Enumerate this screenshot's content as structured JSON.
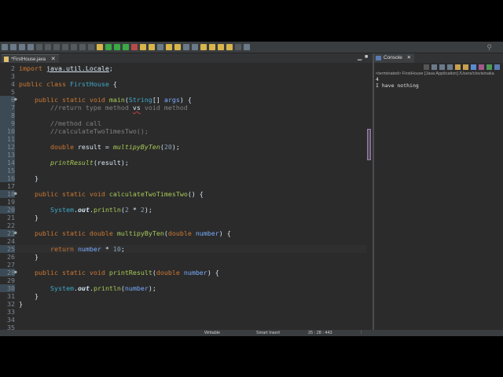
{
  "editor": {
    "tab_label": "*FirstHouse.java",
    "current_line": 25,
    "lines": [
      {
        "n": 2,
        "t": [
          [
            "k",
            "import "
          ],
          [
            "u",
            "java.util.Locale"
          ],
          [
            "",
            "; "
          ]
        ]
      },
      {
        "n": 3,
        "t": []
      },
      {
        "n": 4,
        "t": [
          [
            "k",
            "public class "
          ],
          [
            "cl",
            "FirstHouse"
          ],
          [
            "",
            " {"
          ]
        ]
      },
      {
        "n": 5,
        "t": []
      },
      {
        "n": 6,
        "t": [
          [
            "",
            "    "
          ],
          [
            "k",
            "public static void "
          ],
          [
            "m",
            "main"
          ],
          [
            "",
            "("
          ],
          [
            "cl",
            "String"
          ],
          [
            "",
            "[] "
          ],
          [
            "p",
            "args"
          ],
          [
            "",
            ") {"
          ]
        ]
      },
      {
        "n": 7,
        "t": [
          [
            "c",
            "        //return type method "
          ],
          [
            "ww",
            "vs"
          ],
          [
            "c",
            " void method"
          ]
        ]
      },
      {
        "n": 8,
        "t": []
      },
      {
        "n": 9,
        "t": [
          [
            "c",
            "        //method call"
          ]
        ]
      },
      {
        "n": 10,
        "t": [
          [
            "c",
            "        //calculateTwoTimesTwo();"
          ]
        ]
      },
      {
        "n": 11,
        "t": []
      },
      {
        "n": 12,
        "t": [
          [
            "",
            "        "
          ],
          [
            "k",
            "double "
          ],
          [
            "",
            "result = "
          ],
          [
            "s",
            "multipyByTen"
          ],
          [
            "",
            "("
          ],
          [
            "n",
            "20"
          ],
          [
            "",
            ");"
          ]
        ]
      },
      {
        "n": 13,
        "t": []
      },
      {
        "n": 14,
        "t": [
          [
            "",
            "        "
          ],
          [
            "s",
            "printResult"
          ],
          [
            "",
            "(result);"
          ]
        ]
      },
      {
        "n": 15,
        "t": []
      },
      {
        "n": 16,
        "t": [
          [
            "",
            "    }"
          ]
        ]
      },
      {
        "n": 17,
        "t": []
      },
      {
        "n": 18,
        "t": [
          [
            "",
            "    "
          ],
          [
            "k",
            "public static void "
          ],
          [
            "m",
            "calculateTwoTimesTwo"
          ],
          [
            "",
            "() {"
          ]
        ]
      },
      {
        "n": 19,
        "t": []
      },
      {
        "n": 20,
        "t": [
          [
            "",
            "        "
          ],
          [
            "cl",
            "System"
          ],
          [
            "",
            "."
          ],
          [
            "f",
            "out"
          ],
          [
            "",
            "."
          ],
          [
            "m",
            "println"
          ],
          [
            "",
            "("
          ],
          [
            "n",
            "2"
          ],
          [
            "",
            " * "
          ],
          [
            "n",
            "2"
          ],
          [
            "",
            ");"
          ]
        ]
      },
      {
        "n": 21,
        "t": [
          [
            "",
            "    }"
          ]
        ]
      },
      {
        "n": 22,
        "t": []
      },
      {
        "n": 23,
        "t": [
          [
            "",
            "    "
          ],
          [
            "k",
            "public static double "
          ],
          [
            "m",
            "multipyByTen"
          ],
          [
            "",
            "("
          ],
          [
            "k",
            "double "
          ],
          [
            "p",
            "number"
          ],
          [
            "",
            ") {"
          ]
        ]
      },
      {
        "n": 24,
        "t": []
      },
      {
        "n": 25,
        "t": [
          [
            "",
            "        "
          ],
          [
            "k",
            "return "
          ],
          [
            "p",
            "number"
          ],
          [
            "",
            " * "
          ],
          [
            "n",
            "10"
          ],
          [
            "",
            ";"
          ]
        ]
      },
      {
        "n": 26,
        "t": [
          [
            "",
            "    }"
          ]
        ]
      },
      {
        "n": 27,
        "t": []
      },
      {
        "n": 28,
        "t": [
          [
            "",
            "    "
          ],
          [
            "k",
            "public static void "
          ],
          [
            "m",
            "printResult"
          ],
          [
            "",
            "("
          ],
          [
            "k",
            "double "
          ],
          [
            "p",
            "number"
          ],
          [
            "",
            ") {"
          ]
        ]
      },
      {
        "n": 29,
        "t": []
      },
      {
        "n": 30,
        "t": [
          [
            "",
            "        "
          ],
          [
            "cl",
            "System"
          ],
          [
            "",
            "."
          ],
          [
            "f",
            "out"
          ],
          [
            "",
            "."
          ],
          [
            "m",
            "println"
          ],
          [
            "",
            "("
          ],
          [
            "p",
            "number"
          ],
          [
            "",
            ");"
          ]
        ]
      },
      {
        "n": 31,
        "t": [
          [
            "",
            "    }"
          ]
        ]
      },
      {
        "n": 32,
        "t": [
          [
            "",
            "}"
          ]
        ]
      },
      {
        "n": 33,
        "t": []
      },
      {
        "n": 34,
        "t": []
      },
      {
        "n": 35,
        "t": []
      }
    ],
    "folds": [
      6,
      18,
      23,
      28
    ]
  },
  "console": {
    "tab_label": "Console",
    "terminated": "<terminated> FirstHouse [Java Application] /Users/clovisinaka",
    "output": [
      "4",
      "I have nothing"
    ]
  },
  "status": {
    "writable": "Writable",
    "insert_mode": "Smart Insert",
    "position": "25 : 28 : 443"
  }
}
